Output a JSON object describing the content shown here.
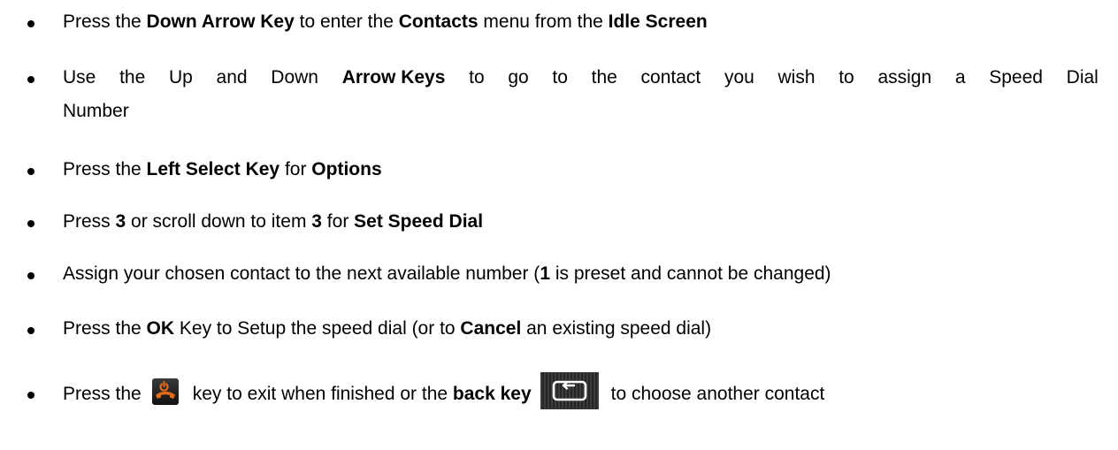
{
  "steps": [
    {
      "segments": [
        {
          "text": "Press the ",
          "bold": false
        },
        {
          "text": "Down Arrow Key",
          "bold": true
        },
        {
          "text": " to enter the ",
          "bold": false
        },
        {
          "text": "Contacts",
          "bold": true
        },
        {
          "text": " menu from the ",
          "bold": false
        },
        {
          "text": "Idle Screen",
          "bold": true
        }
      ]
    },
    {
      "line1_words": [
        "Use",
        "the",
        "Up",
        "and",
        "Down",
        "Arrow Keys",
        "to",
        "go",
        "to",
        "the",
        "contact",
        "you",
        "wish",
        "to",
        "assign",
        "a",
        "Speed",
        "Dial"
      ],
      "line1_bold": [
        "Arrow Keys"
      ],
      "line2": "Number"
    },
    {
      "segments": [
        {
          "text": "Press the ",
          "bold": false
        },
        {
          "text": "Left Select Key",
          "bold": true
        },
        {
          "text": " for ",
          "bold": false
        },
        {
          "text": "Options",
          "bold": true
        }
      ]
    },
    {
      "segments": [
        {
          "text": "Press ",
          "bold": false
        },
        {
          "text": "3",
          "bold": true
        },
        {
          "text": " or scroll down to item ",
          "bold": false
        },
        {
          "text": "3",
          "bold": true
        },
        {
          "text": " for ",
          "bold": false
        },
        {
          "text": "Set Speed Dial",
          "bold": true
        }
      ]
    },
    {
      "segments": [
        {
          "text": "Assign your chosen contact to the next available number (",
          "bold": false
        },
        {
          "text": "1",
          "bold": true
        },
        {
          "text": " is preset and cannot be changed)",
          "bold": false
        }
      ]
    },
    {
      "segments": [
        {
          "text": "Press the ",
          "bold": false
        },
        {
          "text": "OK",
          "bold": true
        },
        {
          "text": " Key to Setup the speed dial (or to ",
          "bold": false
        },
        {
          "text": "Cancel",
          "bold": true
        },
        {
          "text": " an existing speed dial)",
          "bold": false
        }
      ]
    },
    {
      "part1": "Press the",
      "icon1": "end-call-key-icon",
      "part2": "key to exit when finished or the ",
      "bold": "back key",
      "icon2": "back-key-icon",
      "part3": "to choose another contact"
    }
  ],
  "colors": {
    "text": "#000000",
    "end_call_icon": "#e06a1b",
    "back_icon": "#2e2e2e"
  }
}
